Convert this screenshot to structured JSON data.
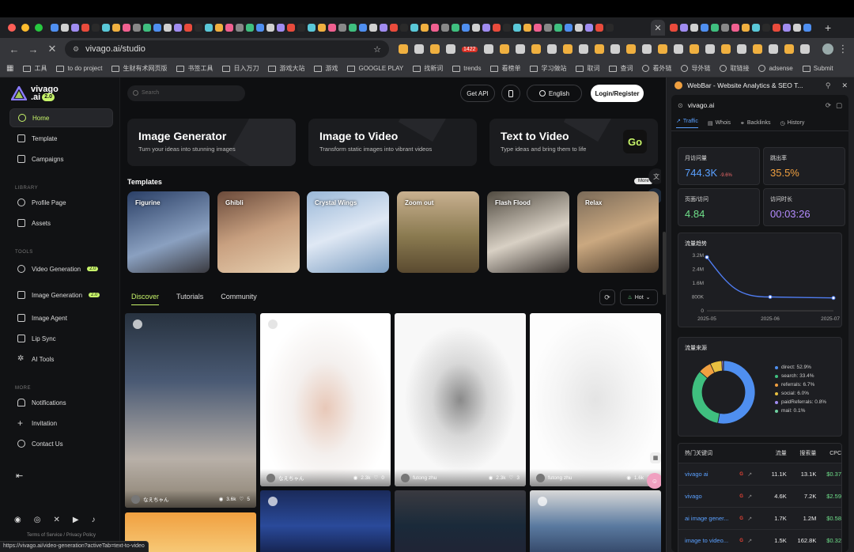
{
  "browser": {
    "address_url": "vivago.ai/studio",
    "ext_badge": "1422",
    "bookmarks": [
      "工具",
      "to do project",
      "生财有术网页版",
      "书签工具",
      "日入万刀",
      "游戏大站",
      "游戏",
      "GOOGLE PLAY",
      "找新词",
      "trends",
      "看榜单",
      "学习做站",
      "取词",
      "查词",
      "看外链",
      "导外链",
      "取链接",
      "adsense",
      "Submit"
    ],
    "status_url": "https://vivago.ai/video-generation?activeTab=text-to-video"
  },
  "logo": {
    "name_line1": "vivago",
    "name_line2": ".ai",
    "version": "2.0"
  },
  "sidebar": {
    "primary": [
      {
        "label": "Home",
        "icon": "home-icon"
      },
      {
        "label": "Template",
        "icon": "template-icon"
      },
      {
        "label": "Campaigns",
        "icon": "campaign-icon"
      }
    ],
    "library_label": "LIBRARY",
    "library": [
      {
        "label": "Profile Page",
        "icon": "user-icon"
      },
      {
        "label": "Assets",
        "icon": "assets-icon"
      }
    ],
    "tools_label": "TOOLS",
    "tools": [
      {
        "label": "Video Generation",
        "icon": "video-icon",
        "badge": "2.0"
      },
      {
        "label": "Image Generation",
        "icon": "image-icon",
        "badge": "2.0"
      },
      {
        "label": "Image Agent",
        "icon": "agent-icon"
      },
      {
        "label": "Lip Sync",
        "icon": "lip-icon"
      },
      {
        "label": "AI Tools",
        "icon": "sparkle-icon"
      }
    ],
    "more_label": "MORE",
    "more": [
      {
        "label": "Notifications",
        "icon": "bell-icon"
      },
      {
        "label": "Invitation",
        "icon": "plus-icon"
      },
      {
        "label": "Contact Us",
        "icon": "contact-icon"
      }
    ],
    "terms": "Terms of Service",
    "privacy": "Privacy Policy"
  },
  "header": {
    "search_placeholder": "Search",
    "get_api": "Get API",
    "language": "English",
    "login": "Login/Register"
  },
  "heroes": [
    {
      "title": "Image Generator",
      "subtitle": "Turn your ideas into stunning images"
    },
    {
      "title": "Image to Video",
      "subtitle": "Transform static images into vibrant videos"
    },
    {
      "title": "Text to Video",
      "subtitle": "Type ideas and bring them to life",
      "cta": "Go"
    }
  ],
  "templates": {
    "title": "Templates",
    "more": "More",
    "items": [
      "Figurine",
      "Ghibli",
      "Crystal Wings",
      "Zoom out",
      "Flash Flood",
      "Relax"
    ]
  },
  "feed": {
    "tabs": [
      "Discover",
      "Tutorials",
      "Community"
    ],
    "sort": "Hot",
    "cards": [
      {
        "author": "なえちゃん",
        "views": "3.6k",
        "likes": "5"
      },
      {
        "author": "なえちゃん",
        "views": "2.3k",
        "likes": "0"
      },
      {
        "author": "futong zhu",
        "views": "2.3k",
        "likes": "3"
      },
      {
        "author": "futong zhu",
        "views": "1.6k",
        "likes": ""
      }
    ]
  },
  "webbar": {
    "title": "WebBar - Website Analytics & SEO T...",
    "site": "vivago.ai",
    "tabs": [
      "Traffic",
      "Whois",
      "Backlinks",
      "History"
    ],
    "stats": [
      {
        "label": "月访问量",
        "value": "744.3K",
        "delta": "-9.6%",
        "color": "#5aa0ff"
      },
      {
        "label": "跳出率",
        "value": "35.5%",
        "color": "#f0a040"
      },
      {
        "label": "页面/访问",
        "value": "4.84",
        "color": "#6fe08a"
      },
      {
        "label": "访问时长",
        "value": "00:03:26",
        "color": "#b58cff"
      }
    ],
    "trend_title": "流量趋势",
    "source_title": "流量来源",
    "keywords_title": "热门关键词",
    "keyword_cols": [
      "流量",
      "搜索量",
      "CPC"
    ],
    "keywords": [
      {
        "name": "vivago ai",
        "traffic": "11.1K",
        "search": "13.1K",
        "cpc": "$0.37"
      },
      {
        "name": "vivago",
        "traffic": "4.6K",
        "search": "7.2K",
        "cpc": "$2.59"
      },
      {
        "name": "ai image gener...",
        "traffic": "1.7K",
        "search": "1.2M",
        "cpc": "$0.58"
      },
      {
        "name": "image to video...",
        "traffic": "1.5K",
        "search": "162.8K",
        "cpc": "$0.32"
      }
    ]
  },
  "chart_data": [
    {
      "type": "line",
      "title": "流量趋势",
      "x": [
        "2025-05",
        "2025-06",
        "2025-07"
      ],
      "series": [
        {
          "values": [
            3100000,
            800000,
            744300
          ]
        }
      ],
      "y_ticks": [
        "3.2M",
        "2.4M",
        "1.6M",
        "800K",
        "0"
      ],
      "ylim": [
        0,
        3200000
      ],
      "color": "#4f7cf0"
    },
    {
      "type": "pie",
      "title": "流量来源",
      "labels": [
        "direct",
        "search",
        "referrals",
        "social",
        "paidReferrals",
        "mail"
      ],
      "values": [
        52.9,
        33.4,
        6.7,
        6.0,
        0.8,
        0.1
      ],
      "display": [
        "direct: 52.9%",
        "search: 33.4%",
        "referrals: 6.7%",
        "social: 6.0%",
        "paidReferrals: 0.8%",
        "mail: 0.1%"
      ],
      "colors": [
        "#4f8ff0",
        "#3fbf7f",
        "#f0a040",
        "#e8c040",
        "#a08cf0",
        "#6fd0a0"
      ]
    }
  ]
}
